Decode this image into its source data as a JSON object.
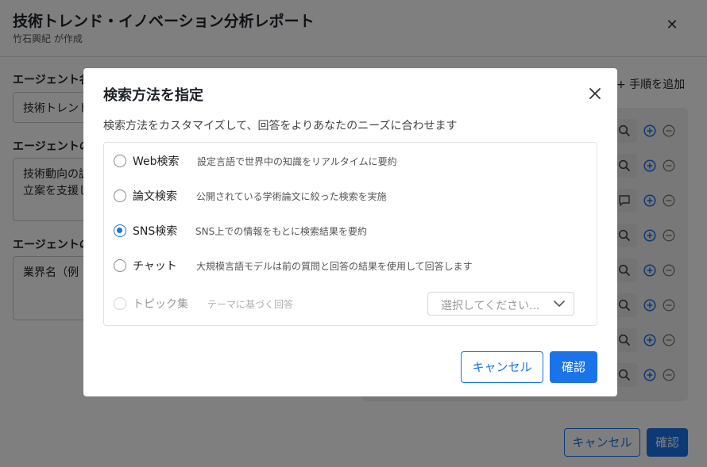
{
  "page": {
    "title": "技術トレンド・イノベーション分析レポート",
    "subtitle": "竹石興紀 が作成",
    "close_icon": "close-icon",
    "fields": [
      {
        "label": "エージェント名",
        "value": "技術トレンド"
      },
      {
        "label": "エージェントの",
        "value": "技術動向の調\n立案を支援し"
      },
      {
        "label": "エージェントの",
        "value": "業界名（例"
      }
    ],
    "add_step_label": "+ 手順を追加",
    "step_icons": [
      "search-icon",
      "search-icon",
      "chat-icon",
      "search-icon",
      "search-icon",
      "search-icon",
      "search-icon",
      "search-icon"
    ],
    "cancel_label": "キャンセル",
    "confirm_label": "確認"
  },
  "modal": {
    "title": "検索方法を指定",
    "description": "検索方法をカスタマイズして、回答をよりあなたのニーズに合わせます",
    "options": [
      {
        "label": "Web検索",
        "description": "設定言語で世界中の知識をリアルタイムに要約",
        "selected": false,
        "disabled": false
      },
      {
        "label": "論文検索",
        "description": "公開されている学術論文に絞った検索を実施",
        "selected": false,
        "disabled": false
      },
      {
        "label": "SNS検索",
        "description": "SNS上での情報をもとに検索結果を要約",
        "selected": true,
        "disabled": false
      },
      {
        "label": "チャット",
        "description": "大規模言語モデルは前の質問と回答の結果を使用して回答します",
        "selected": false,
        "disabled": false
      },
      {
        "label": "トピック集",
        "description": "テーマに基づく回答",
        "selected": false,
        "disabled": true
      }
    ],
    "topic_select_placeholder": "選択してください...",
    "cancel_label": "キャンセル",
    "confirm_label": "確認"
  },
  "colors": {
    "accent": "#1a73e8",
    "overlay": "rgba(0,0,0,0.5)"
  }
}
